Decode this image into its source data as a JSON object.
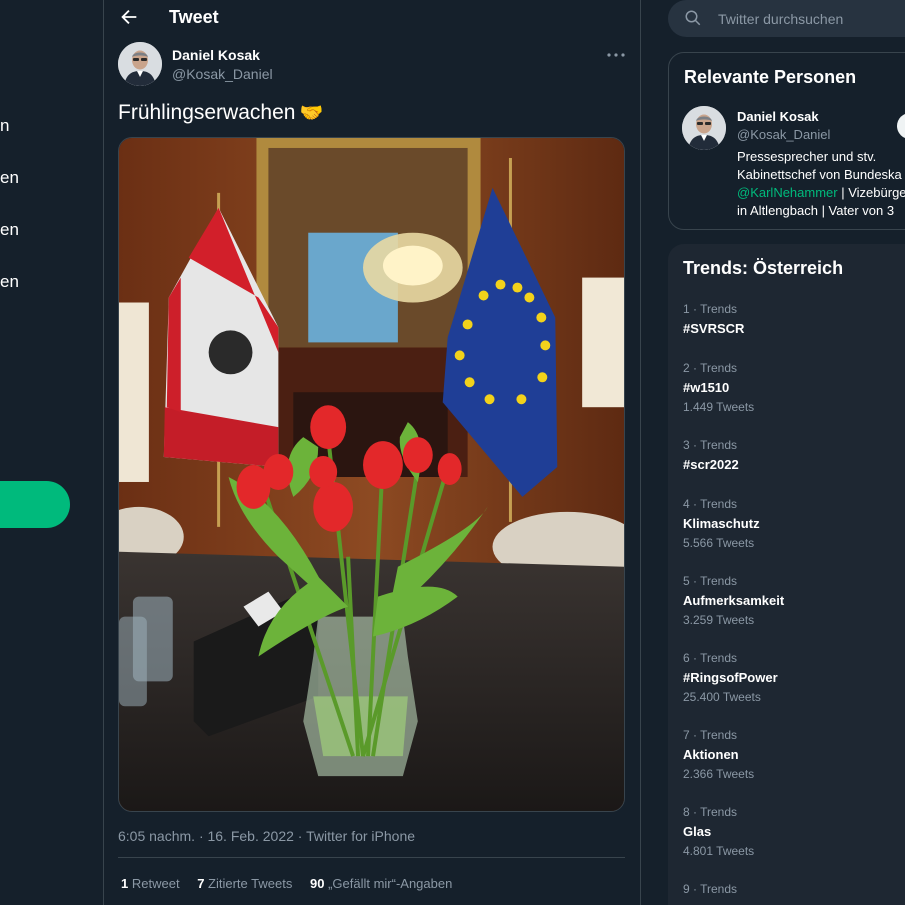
{
  "nav": {
    "items": [
      "n",
      "en",
      "en",
      "en"
    ]
  },
  "header": {
    "title": "Tweet"
  },
  "tweet": {
    "author_name": "Daniel Kosak",
    "author_handle": "@Kosak_Daniel",
    "text": "Frühlingserwachen",
    "emoji": "🤝",
    "meta": "6:05 nachm. · 16. Feb. 2022 · Twitter for iPhone",
    "stats": [
      {
        "count": "1",
        "label": "Retweet"
      },
      {
        "count": "7",
        "label": "Zitierte Tweets"
      },
      {
        "count": "90",
        "label": "„Gefällt mir“-Angaben"
      }
    ]
  },
  "search": {
    "placeholder": "Twitter durchsuchen"
  },
  "relevant": {
    "title": "Relevante Personen",
    "name": "Daniel Kosak",
    "handle": "@Kosak_Daniel",
    "bio_line1": "Pressesprecher und stv.",
    "bio_line2": "Kabinettschef von Bundeska",
    "bio_mention": "@KarlNehammer",
    "bio_line3_rest": " | Vizebürge",
    "bio_line4": "in Altlengbach | Vater von 3"
  },
  "trends": {
    "title": "Trends: Österreich",
    "items": [
      {
        "meta": "1 · Trends",
        "name": "#SVRSCR",
        "count": ""
      },
      {
        "meta": "2 · Trends",
        "name": "#w1510",
        "count": "1.449 Tweets"
      },
      {
        "meta": "3 · Trends",
        "name": "#scr2022",
        "count": ""
      },
      {
        "meta": "4 · Trends",
        "name": "Klimaschutz",
        "count": "5.566 Tweets"
      },
      {
        "meta": "5 · Trends",
        "name": "Aufmerksamkeit",
        "count": "3.259 Tweets"
      },
      {
        "meta": "6 · Trends",
        "name": "#RingsofPower",
        "count": "25.400 Tweets"
      },
      {
        "meta": "7 · Trends",
        "name": "Aktionen",
        "count": "2.366 Tweets"
      },
      {
        "meta": "8 · Trends",
        "name": "Glas",
        "count": "4.801 Tweets"
      },
      {
        "meta": "9 · Trends",
        "name": "",
        "count": ""
      }
    ]
  },
  "colors": {
    "background": "#15202b",
    "accent": "#00ba7c",
    "secondary_text": "#8b98a5",
    "card": "#1e2732"
  }
}
